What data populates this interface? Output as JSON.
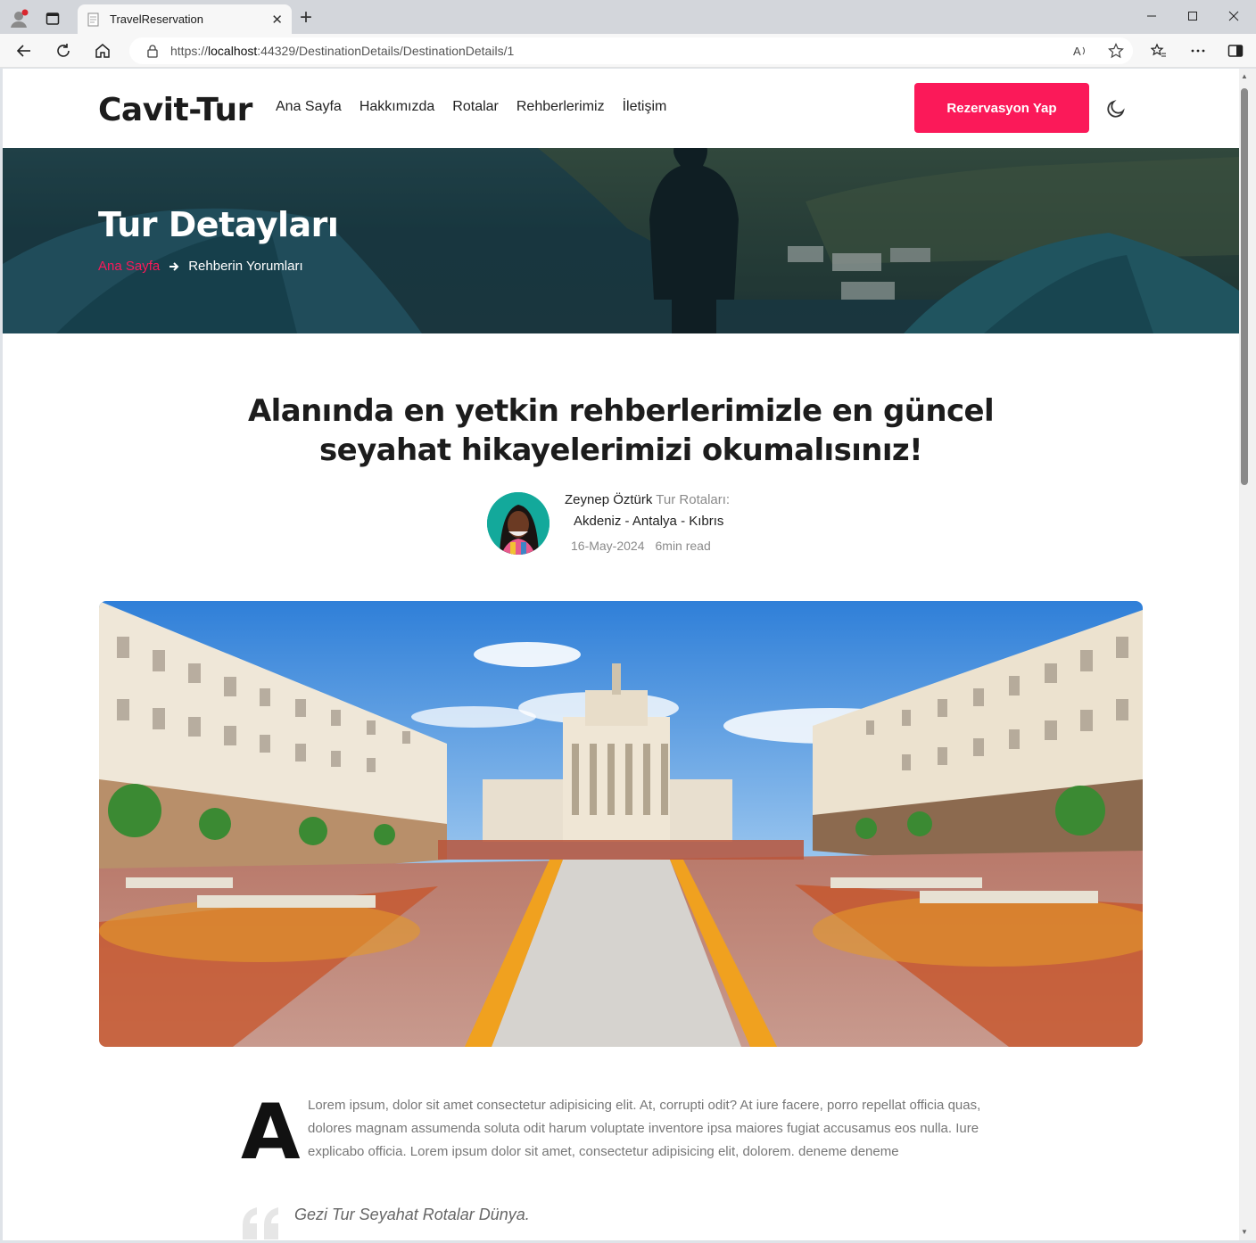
{
  "browser": {
    "tab_title": "TravelReservation",
    "url_prefix": "https://",
    "url_host": "localhost",
    "url_rest": ":44329/DestinationDetails/DestinationDetails/1"
  },
  "header": {
    "logo": "Cavit-Tur",
    "menu": [
      "Ana Sayfa",
      "Hakkımızda",
      "Rotalar",
      "Rehberlerimiz",
      "İletişim"
    ],
    "cta": "Rezervasyon Yap"
  },
  "hero": {
    "title": "Tur Detayları",
    "breadcrumb_home": "Ana Sayfa",
    "breadcrumb_current": "Rehberin Yorumları"
  },
  "article": {
    "headline_line1": "Alanında en yetkin rehberlerimizle en güncel",
    "headline_line2": "seyahat hikayelerimizi okumalısınız!",
    "author_name": "Zeynep Öztürk",
    "route_label": "Tur Rotaları:",
    "route": "Akdeniz - Antalya - Kıbrıs",
    "date": "16-May-2024",
    "read_time": "6min read",
    "dropcap": "A",
    "lead_text": "Lorem ipsum, dolor sit amet consectetur adipisicing elit. At, corrupti odit? At iure facere, porro repellat officia quas, dolores magnam assumenda soluta odit harum voluptate inventore ipsa maiores fugiat accusamus eos nulla. Iure explicabo officia. Lorem ipsum dolor sit amet, consectetur adipisicing elit, dolorem. deneme deneme",
    "quote": "Gezi Tur Seyahat Rotalar Dünya."
  },
  "colors": {
    "accent": "#fb1959",
    "text_dark": "#1c1c1c",
    "muted": "#8a8a8a"
  }
}
